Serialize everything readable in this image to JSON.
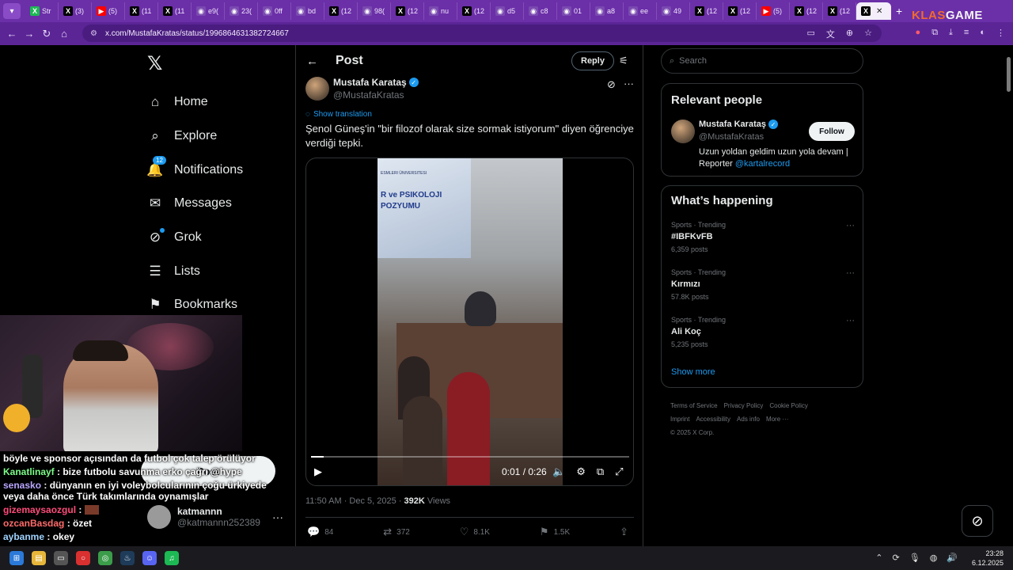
{
  "browser": {
    "tabs": [
      {
        "label": "Str",
        "icon": "x",
        "color": "#1db954"
      },
      {
        "label": "(3)",
        "icon": "x",
        "color": "#000000"
      },
      {
        "label": "(5)",
        "icon": "youtube",
        "color": "#ff0000"
      },
      {
        "label": "(11",
        "icon": "x",
        "color": "#000000"
      },
      {
        "label": "(11",
        "icon": "x",
        "color": "#000000"
      },
      {
        "label": "e9(",
        "icon": "web",
        "color": "#7a4ab0"
      },
      {
        "label": "23(",
        "icon": "web",
        "color": "#7a4ab0"
      },
      {
        "label": "0ff",
        "icon": "web",
        "color": "#7a4ab0"
      },
      {
        "label": "bd",
        "icon": "web",
        "color": "#7a4ab0"
      },
      {
        "label": "(12",
        "icon": "x",
        "color": "#000000"
      },
      {
        "label": "98(",
        "icon": "web",
        "color": "#7a4ab0"
      },
      {
        "label": "(12",
        "icon": "x",
        "color": "#000000"
      },
      {
        "label": "nu",
        "icon": "web",
        "color": "#7a4ab0"
      },
      {
        "label": "(12",
        "icon": "x",
        "color": "#000000"
      },
      {
        "label": "d5",
        "icon": "web",
        "color": "#7a4ab0"
      },
      {
        "label": "c8",
        "icon": "web",
        "color": "#7a4ab0"
      },
      {
        "label": "01",
        "icon": "web",
        "color": "#7a4ab0"
      },
      {
        "label": "a8",
        "icon": "web",
        "color": "#7a4ab0"
      },
      {
        "label": "ee",
        "icon": "web",
        "color": "#7a4ab0"
      },
      {
        "label": "49",
        "icon": "web",
        "color": "#7a4ab0"
      },
      {
        "label": "(12",
        "icon": "x",
        "color": "#000000"
      },
      {
        "label": "(12",
        "icon": "x",
        "color": "#000000"
      },
      {
        "label": "(5)",
        "icon": "youtube",
        "color": "#ff0000"
      },
      {
        "label": "(12",
        "icon": "x",
        "color": "#000000"
      },
      {
        "label": "(12",
        "icon": "x",
        "color": "#000000"
      }
    ],
    "active_tab_close": "✕",
    "new_tab": "+",
    "url": "x.com/MustafaKratas/status/1996864631382724667",
    "overlay_brand": {
      "prefix": "KLAS",
      "suffix": "GAME"
    }
  },
  "sidebar": {
    "logo": "𝕏",
    "items": [
      {
        "label": "Home",
        "icon": "home-icon",
        "glyph": "⌂"
      },
      {
        "label": "Explore",
        "icon": "search-icon",
        "glyph": "⌕"
      },
      {
        "label": "Notifications",
        "icon": "bell-icon",
        "glyph": "🔔",
        "badge": "12"
      },
      {
        "label": "Messages",
        "icon": "envelope-icon",
        "glyph": "✉"
      },
      {
        "label": "Grok",
        "icon": "grok-icon",
        "glyph": "⊘",
        "dot": true
      },
      {
        "label": "Lists",
        "icon": "list-icon",
        "glyph": "☰"
      },
      {
        "label": "Bookmarks",
        "icon": "bookmark-icon",
        "glyph": "⚑"
      }
    ],
    "post_button": "Post",
    "user": {
      "name": "katmannn",
      "handle": "@katmannn252389"
    }
  },
  "post": {
    "header_title": "Post",
    "reply_button": "Reply",
    "author": {
      "name": "Mustafa Karataş",
      "handle": "@MustafaKratas"
    },
    "show_translation": "Show translation",
    "text": "Şenol Güneş'in \"bir filozof olarak size sormak istiyorum\" diyen öğrenciye verdiği tepki.",
    "video": {
      "slide_line1": "R ve PSIKOLOJI",
      "slide_line2": "POZYUMU",
      "slide_top": "ESMLERI ÜNIVERSITESI",
      "time": "0:01 / 0:26",
      "progress": 0.04
    },
    "timestamp": "11:50 AM · Dec 5, 2025 · ",
    "views_count": "392K",
    "views_label": " Views",
    "actions": [
      {
        "name": "reply",
        "glyph": "💬",
        "count": "84"
      },
      {
        "name": "repost",
        "glyph": "⇄",
        "count": "372"
      },
      {
        "name": "like",
        "glyph": "♡",
        "count": "8.1K"
      },
      {
        "name": "bookmark",
        "glyph": "⚑",
        "count": "1.5K"
      },
      {
        "name": "share",
        "glyph": "⇪",
        "count": ""
      }
    ]
  },
  "right": {
    "search_placeholder": "Search",
    "relevant_people": {
      "title": "Relevant people",
      "name": "Mustafa Karataş",
      "handle": "@MustafaKratas",
      "bio": "Uzun yoldan geldim uzun yola devam | Reporter ",
      "bio_link": "@kartalrecord",
      "follow": "Follow"
    },
    "whats_happening": {
      "title": "What’s happening",
      "trends": [
        {
          "category": "Sports · Trending",
          "name": "#IBFKvFB",
          "count": "6,359 posts"
        },
        {
          "category": "Sports · Trending",
          "name": "Kırmızı",
          "count": "57.8K posts"
        },
        {
          "category": "Sports · Trending",
          "name": "Ali Koç",
          "count": "5,235 posts"
        }
      ],
      "show_more": "Show more"
    },
    "footer": [
      "Terms of Service",
      "Privacy Policy",
      "Cookie Policy",
      "Imprint",
      "Accessibility",
      "Ads info",
      "More ···",
      "© 2025 X Corp."
    ]
  },
  "stream": {
    "chat": [
      {
        "user": "",
        "user_color": "#ffffff",
        "text": "böyle ve sponsor açısından da futbol çok talep örülüyor"
      },
      {
        "user": "Kanatlinayf",
        "user_color": "#7cfc8a",
        "text": " : bize futbolu savunma erko çağrı @hype"
      },
      {
        "user": "senasko",
        "user_color": "#b9a6ff",
        "text": " : dünyanın en iyi voleybolcularının çoğu ürkiyede veya daha önce Türk takımlarında oynamışlar"
      },
      {
        "user": "gizemaysaozgul",
        "user_color": "#ff4b7a",
        "text": " :"
      },
      {
        "user": "ozcanBasdag",
        "user_color": "#ff6b6b",
        "text": " : özet"
      },
      {
        "user": "aybanme",
        "user_color": "#9fd3ff",
        "text": " : okey"
      }
    ]
  },
  "taskbar": {
    "time": "23:28",
    "date": "6.12.2025"
  }
}
